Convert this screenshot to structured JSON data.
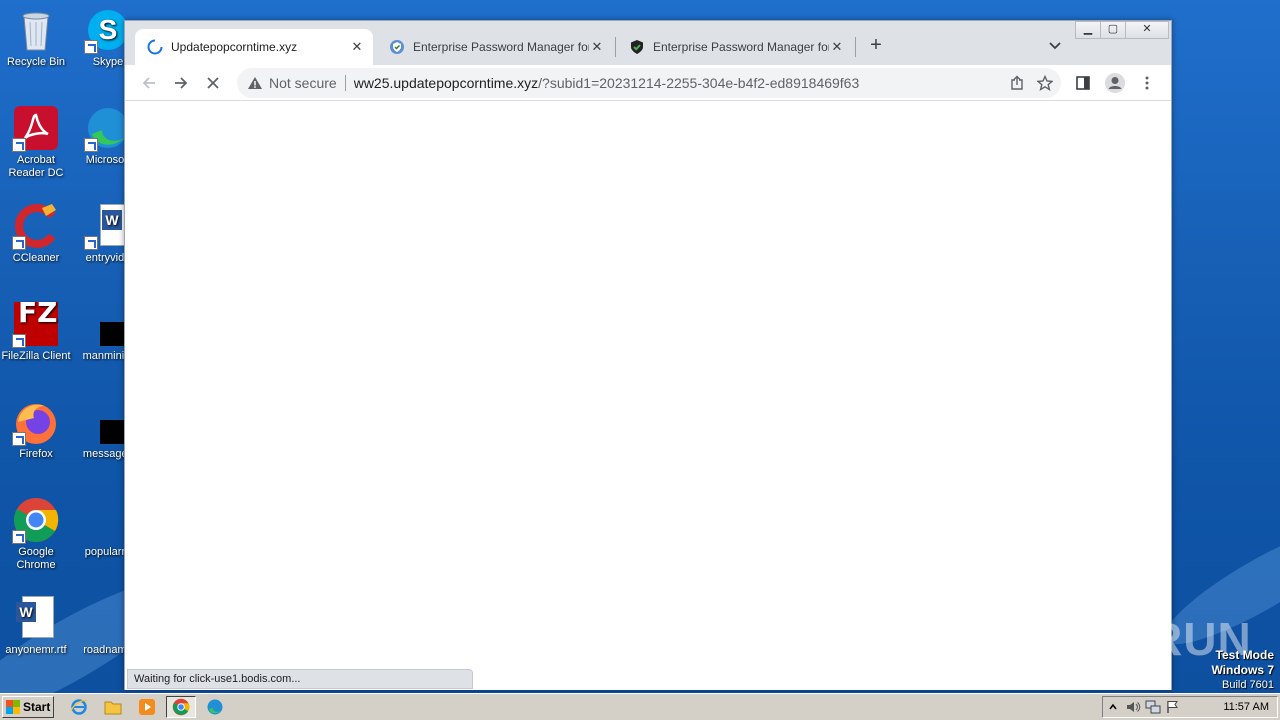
{
  "desktop": {
    "icons": [
      {
        "label": "Recycle Bin"
      },
      {
        "label": "Skype"
      },
      {
        "label": "Acrobat Reader DC"
      },
      {
        "label": "Microsoft"
      },
      {
        "label": "CCleaner"
      },
      {
        "label": "entryvide"
      },
      {
        "label": "FileZilla Client"
      },
      {
        "label": "manminim"
      },
      {
        "label": "Firefox"
      },
      {
        "label": "messages"
      },
      {
        "label": "Google Chrome"
      },
      {
        "label": "popularre"
      },
      {
        "label": "anyonemr.rtf"
      },
      {
        "label": "roadname"
      }
    ]
  },
  "browser": {
    "tabs": [
      {
        "title": "Updatepopcorntime.xyz",
        "icon": "loading-spinner-icon",
        "active": true
      },
      {
        "title": "Enterprise Password Manager for Te",
        "icon": "shield-check-blue-icon",
        "active": false
      },
      {
        "title": "Enterprise Password Manager for Te",
        "icon": "shield-check-green-icon",
        "active": false
      }
    ],
    "security_label": "Not secure",
    "url_host": "ww25.updatepopcorntime.xyz",
    "url_path": "/?subid1=20231214-2255-304e-b4f2-ed8918469f63",
    "status_text": "Waiting for click-use1.bodis.com..."
  },
  "watermark": {
    "text": "ANY RUN",
    "test_mode_line1": "Test Mode",
    "test_mode_line2": "Windows 7",
    "test_mode_line3": "Build 7601"
  },
  "taskbar": {
    "start_label": "Start",
    "clock": "11:57 AM"
  },
  "colors": {
    "desktop_blue": "#1760b6",
    "chrome_tabstrip": "#dee1e6",
    "taskbar": "#d4d0c8"
  }
}
